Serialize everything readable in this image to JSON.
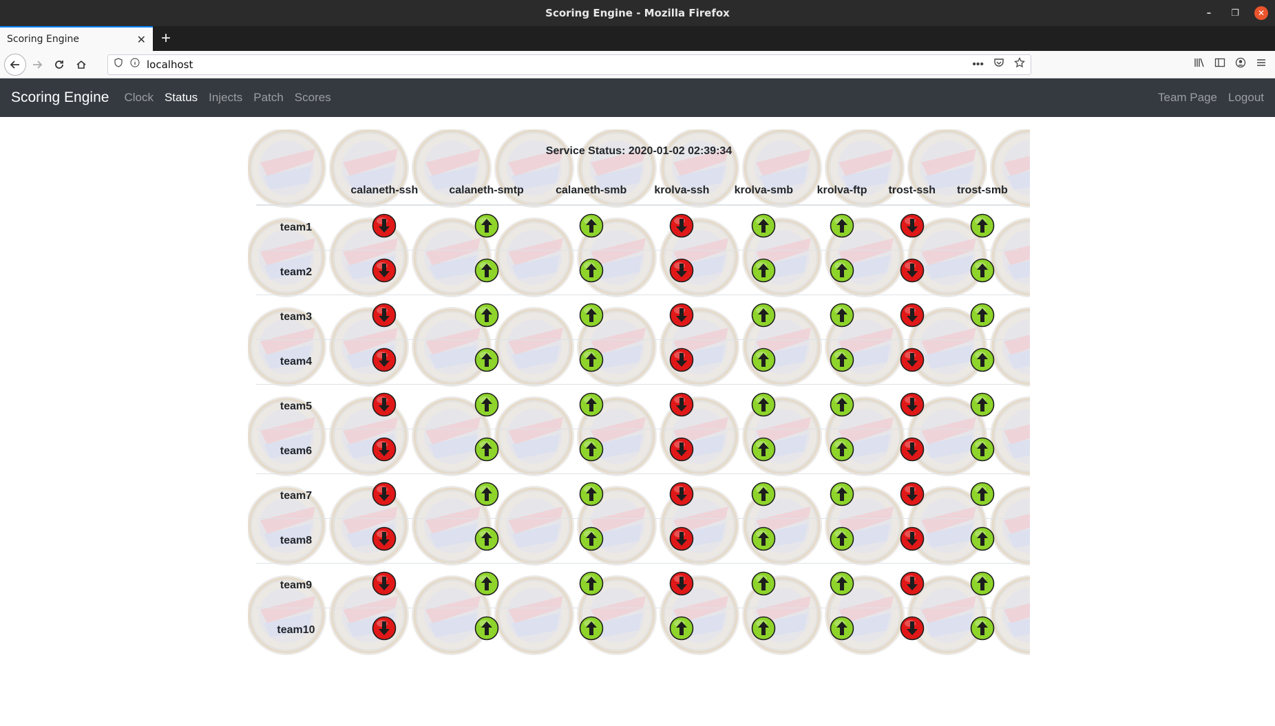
{
  "window": {
    "title": "Scoring Engine - Mozilla Firefox"
  },
  "browser": {
    "tab_title": "Scoring Engine",
    "url": "localhost"
  },
  "nav": {
    "brand": "Scoring Engine",
    "links": [
      "Clock",
      "Status",
      "Injects",
      "Patch",
      "Scores"
    ],
    "active": "Status",
    "right_links": [
      "Team Page",
      "Logout"
    ]
  },
  "status": {
    "title": "Service Status: 2020-01-02 02:39:34",
    "services": [
      "calaneth-ssh",
      "calaneth-smtp",
      "calaneth-smb",
      "krolva-ssh",
      "krolva-smb",
      "krolva-ftp",
      "trost-ssh",
      "trost-smb"
    ],
    "teams": [
      {
        "name": "team1",
        "states": [
          "down",
          "up",
          "up",
          "down",
          "up",
          "up",
          "down",
          "up"
        ]
      },
      {
        "name": "team2",
        "states": [
          "down",
          "up",
          "up",
          "down",
          "up",
          "up",
          "down",
          "up"
        ]
      },
      {
        "name": "team3",
        "states": [
          "down",
          "up",
          "up",
          "down",
          "up",
          "up",
          "down",
          "up"
        ]
      },
      {
        "name": "team4",
        "states": [
          "down",
          "up",
          "up",
          "down",
          "up",
          "up",
          "down",
          "up"
        ]
      },
      {
        "name": "team5",
        "states": [
          "down",
          "up",
          "up",
          "down",
          "up",
          "up",
          "down",
          "up"
        ]
      },
      {
        "name": "team6",
        "states": [
          "down",
          "up",
          "up",
          "down",
          "up",
          "up",
          "down",
          "up"
        ]
      },
      {
        "name": "team7",
        "states": [
          "down",
          "up",
          "up",
          "down",
          "up",
          "up",
          "down",
          "up"
        ]
      },
      {
        "name": "team8",
        "states": [
          "down",
          "up",
          "up",
          "down",
          "up",
          "up",
          "down",
          "up"
        ]
      },
      {
        "name": "team9",
        "states": [
          "down",
          "up",
          "up",
          "down",
          "up",
          "up",
          "down",
          "up"
        ]
      },
      {
        "name": "team10",
        "states": [
          "down",
          "up",
          "up",
          "up",
          "up",
          "up",
          "down",
          "up"
        ]
      }
    ]
  },
  "colors": {
    "up": "#8ed42b",
    "down": "#e01818",
    "navbar": "#343a40"
  },
  "icons": {
    "up": "up-arrow-icon",
    "down": "down-arrow-icon"
  }
}
